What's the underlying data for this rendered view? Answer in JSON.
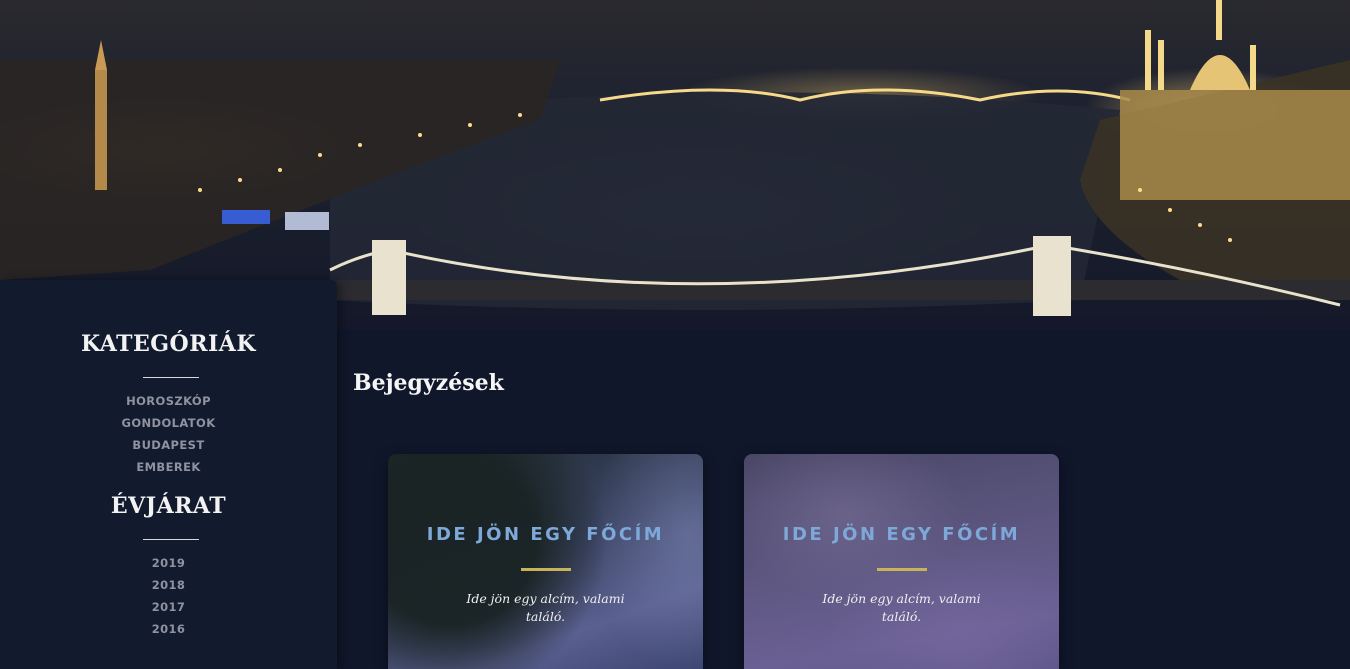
{
  "sidebar": {
    "categories_heading": "KATEGÓRIÁK",
    "categories": [
      "HOROSZKÓP",
      "GONDOLATOK",
      "BUDAPEST",
      "EMBEREK"
    ],
    "years_heading": "ÉVJÁRAT",
    "years": [
      "2019",
      "2018",
      "2017",
      "2016"
    ]
  },
  "main": {
    "section_title": "Bejegyzések",
    "posts": [
      {
        "title": "IDE JÖN EGY FŐCÍM",
        "subtitle": "Ide jön egy alcím, valami találó."
      },
      {
        "title": "IDE JÖN EGY FŐCÍM",
        "subtitle": "Ide jön egy alcím, valami találó."
      }
    ]
  },
  "colors": {
    "page_background": "#10172b",
    "sidebar_background": "#121a2e",
    "card_title": "#7ea8d8",
    "card_rule": "#c9b35a"
  }
}
